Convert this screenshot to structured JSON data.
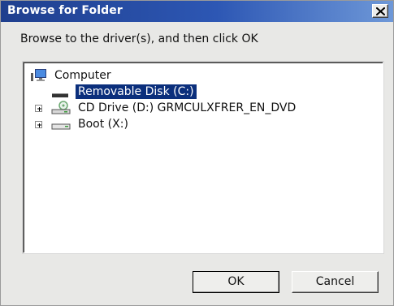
{
  "window": {
    "title": "Browse for Folder"
  },
  "instruction": "Browse to the driver(s), and then click OK",
  "tree": {
    "root": {
      "label": "Computer",
      "icon": "computer-icon"
    },
    "items": [
      {
        "label": "Removable Disk (C:)",
        "icon": "removable-disk-icon",
        "selected": true,
        "expandable": false
      },
      {
        "label": "CD Drive (D:) GRMCULXFRER_EN_DVD",
        "icon": "cd-drive-icon",
        "selected": false,
        "expandable": true
      },
      {
        "label": "Boot (X:)",
        "icon": "drive-icon",
        "selected": false,
        "expandable": true
      }
    ]
  },
  "buttons": {
    "ok_label": "OK",
    "cancel_label": "Cancel"
  },
  "colors": {
    "title_bar": "#2d57b4",
    "selection": "#0b2f7c",
    "dialog_bg": "#e8e8e6"
  }
}
